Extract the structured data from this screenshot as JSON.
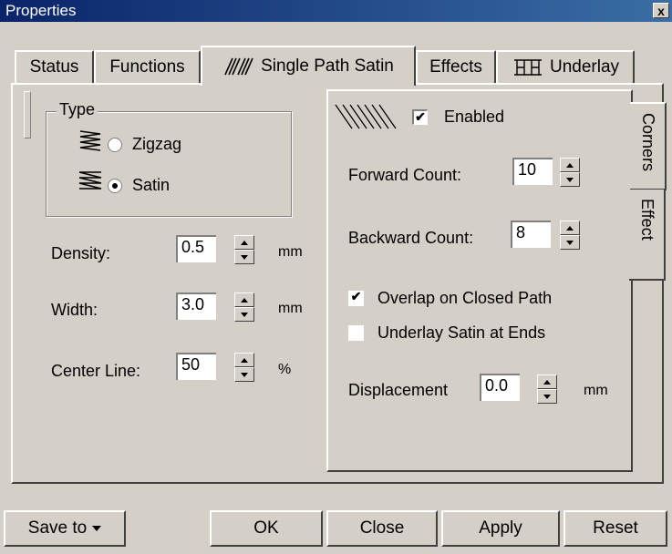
{
  "window": {
    "title": "Properties",
    "close_glyph": "x"
  },
  "tabs": [
    {
      "label": "Status"
    },
    {
      "label": "Functions"
    },
    {
      "label": "Single Path Satin",
      "icon": "satin-stitch-icon",
      "active": true
    },
    {
      "label": "Effects"
    },
    {
      "label": "Underlay",
      "icon": "underlay-icon"
    }
  ],
  "type_group": {
    "label": "Type",
    "options": [
      {
        "label": "Zigzag",
        "checked": false,
        "icon": "zigzag-stitch-icon"
      },
      {
        "label": "Satin",
        "checked": true,
        "icon": "satin-icon"
      }
    ]
  },
  "fields": {
    "density": {
      "label": "Density:",
      "value": "0.5",
      "unit": "mm"
    },
    "width": {
      "label": "Width:",
      "value": "3.0",
      "unit": "mm"
    },
    "center_line": {
      "label": "Center Line:",
      "value": "50",
      "unit": "%"
    }
  },
  "effect_panel": {
    "enabled": {
      "label": "Enabled",
      "checked": true,
      "icon": "hatch-pattern-icon"
    },
    "forward_count": {
      "label": "Forward Count:",
      "value": "10"
    },
    "backward_count": {
      "label": "Backward Count:",
      "value": "8"
    },
    "overlap": {
      "label": "Overlap on Closed Path",
      "checked": true
    },
    "underlay_ends": {
      "label": "Underlay Satin at Ends",
      "checked": false
    },
    "displacement": {
      "label": "Displacement",
      "value": "0.0",
      "unit": "mm"
    },
    "side_tabs": [
      {
        "label": "Corners"
      },
      {
        "label": "Effect",
        "active": true
      }
    ]
  },
  "buttons": {
    "save_to": "Save to",
    "ok": "OK",
    "close": "Close",
    "apply": "Apply",
    "reset": "Reset"
  },
  "colors": {
    "face": "#d4d0c8",
    "title_start": "#0a246a",
    "title_end": "#3a6ea5"
  }
}
